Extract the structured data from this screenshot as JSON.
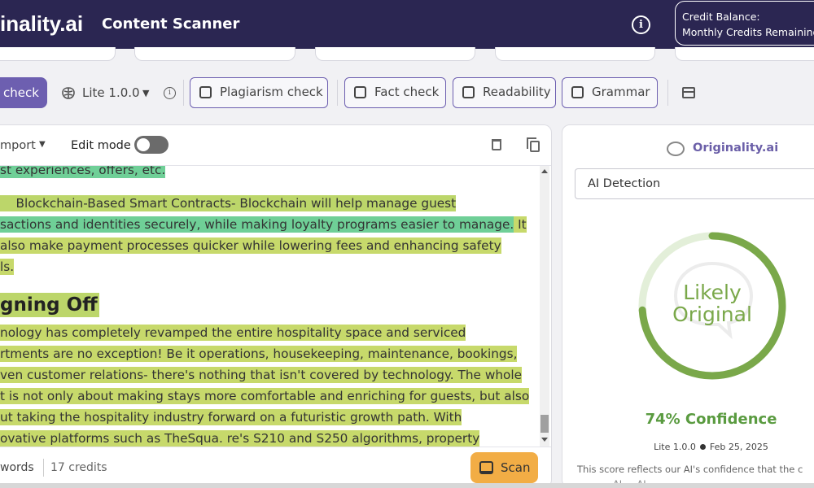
{
  "header": {
    "logo": "inality.ai",
    "title": "Content Scanner",
    "credit_balance_label": "Credit Balance:",
    "monthly_credits_label": "Monthly Credits Remaining"
  },
  "toolbar": {
    "ai_check_label": "check",
    "model_label": "Lite 1.0.0",
    "checks": [
      {
        "label": "Plagiarism check"
      },
      {
        "label": "Fact check"
      },
      {
        "label": "Readability"
      },
      {
        "label": "Grammar"
      }
    ]
  },
  "editor": {
    "import_label": "mport",
    "edit_mode_label": "Edit mode",
    "edit_mode_on": false,
    "lines": [
      "st experiences, offers, etc.",
      "    Blockchain-Based Smart Contracts- Blockchain will help manage guest",
      "sactions and identities securely, while making loyalty programs easier to manage.",
      " It",
      "also make payment processes quicker while lowering fees and enhancing safety",
      "ls.",
      "nology has completely revamped the entire hospitality space and serviced",
      "rtments are no exception!  Be it operations, housekeeping, maintenance, bookings,",
      "ven customer relations- there's nothing that isn't covered by technology.  The whole",
      "t is not only about making stays more comfortable and enriching for guests, but also",
      "ut taking the hospitality industry forward on a futuristic growth path.  With",
      "ovative platforms such as TheSqua.  re's S210 and S250 algorithms, property"
    ],
    "heading": "gning Off",
    "words_label": "words",
    "credits_label": "17 credits",
    "scan_label": "Scan"
  },
  "results": {
    "brand": "Originality.ai",
    "dropdown_value": "AI Detection",
    "verdict_line1": "Likely",
    "verdict_line2": "Original",
    "confidence_text": "74% Confidence",
    "confidence_value": 74,
    "model": "Lite 1.0.0",
    "date": "Feb 25, 2025",
    "explanation": "This score reflects our AI's confidence that the c",
    "explanation2": "...                    ...           ...  AI  ...  AI"
  },
  "colors": {
    "header_bg": "#2b2652",
    "accent_purple": "#6d5fb0",
    "highlight_green": "#6fcf97",
    "highlight_yellow": "#c7d96b",
    "ring_green": "#7aa84a",
    "scan_orange": "#f2ad45"
  }
}
